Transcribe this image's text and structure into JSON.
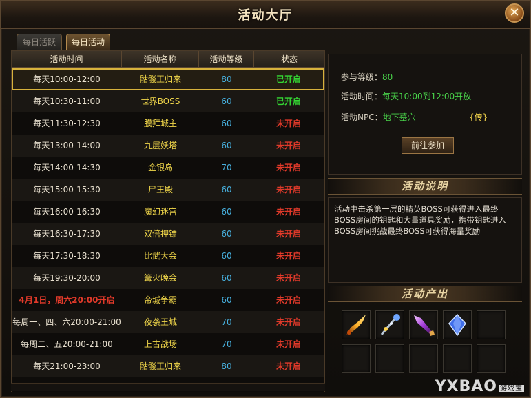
{
  "window": {
    "title": "活动大厅",
    "close_label": "✕"
  },
  "tabs": [
    {
      "label": "每日活跃",
      "active": false
    },
    {
      "label": "每日活动",
      "active": true
    }
  ],
  "table": {
    "headers": [
      "活动时间",
      "活动名称",
      "活动等级",
      "状态"
    ],
    "rows": [
      {
        "time": "每天10:00-12:00",
        "name": "骷髅王归来",
        "level": "80",
        "status": "已开启",
        "open": true
      },
      {
        "time": "每天10:30-11:00",
        "name": "世界BOSS",
        "level": "60",
        "status": "已开启",
        "open": true
      },
      {
        "time": "每天11:30-12:30",
        "name": "膜拜城主",
        "level": "60",
        "status": "未开启",
        "open": false
      },
      {
        "time": "每天13:00-14:00",
        "name": "九层妖塔",
        "level": "60",
        "status": "未开启",
        "open": false
      },
      {
        "time": "每天14:00-14:30",
        "name": "金银岛",
        "level": "70",
        "status": "未开启",
        "open": false
      },
      {
        "time": "每天15:00-15:30",
        "name": "尸王殿",
        "level": "60",
        "status": "未开启",
        "open": false
      },
      {
        "time": "每天16:00-16:30",
        "name": "魔幻迷宫",
        "level": "60",
        "status": "未开启",
        "open": false
      },
      {
        "time": "每天16:30-17:30",
        "name": "双倍押镖",
        "level": "60",
        "status": "未开启",
        "open": false
      },
      {
        "time": "每天17:30-18:30",
        "name": "比武大会",
        "level": "60",
        "status": "未开启",
        "open": false
      },
      {
        "time": "每天19:30-20:00",
        "name": "篝火晚会",
        "level": "60",
        "status": "未开启",
        "open": false
      },
      {
        "time": "4月1日，周六20:00开启",
        "name": "帝城争霸",
        "level": "60",
        "status": "未开启",
        "open": false
      },
      {
        "time": "每周一、四、六20:00-21:00",
        "name": "夜袭王城",
        "level": "70",
        "status": "未开启",
        "open": false
      },
      {
        "time": "每周二、五20:00-21:00",
        "name": "上古战场",
        "level": "70",
        "status": "未开启",
        "open": false
      },
      {
        "time": "每天21:00-23:00",
        "name": "骷髅王归来",
        "level": "80",
        "status": "未开启",
        "open": false
      }
    ]
  },
  "info": {
    "level_label": "参与等级：",
    "level_value": "80",
    "time_label": "活动时间：",
    "time_value": "每天10:00到12:00开放",
    "npc_label": "活动NPC：",
    "npc_value": "地下墓穴",
    "npc_link": "{传}",
    "go_button": "前往参加"
  },
  "description": {
    "title": "活动说明",
    "text": "活动中击杀第一层的精英BOSS可获得进入最终BOSS房间的钥匙和大量道具奖励，携带钥匙进入BOSS房间挑战最终BOSS可获得海量奖励"
  },
  "rewards": {
    "title": "活动产出",
    "items": [
      "flame-sword-icon",
      "ice-wand-icon",
      "purple-blade-icon",
      "blue-crystal-icon",
      "empty",
      "empty",
      "empty",
      "empty",
      "empty",
      "empty"
    ]
  },
  "watermark": {
    "text": "YXBAO",
    "sub": "游戏宝"
  },
  "colors": {
    "open": "#34d633",
    "closed": "#e23a2a",
    "name": "#f0d64a",
    "level": "#47b0de",
    "highlight": "#d8b23c"
  }
}
